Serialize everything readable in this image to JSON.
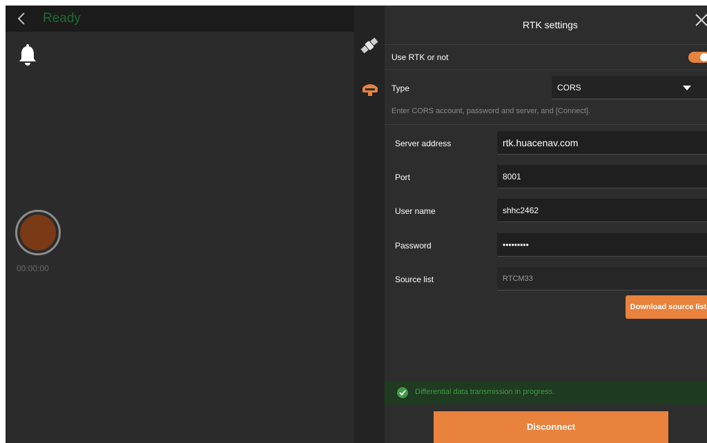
{
  "header": {
    "status": "Ready"
  },
  "recorder": {
    "timer": "00:00:00"
  },
  "panel": {
    "title": "RTK settings",
    "use_rtk": {
      "label": "Use RTK or not",
      "enabled": true
    },
    "type": {
      "label": "Type",
      "value": "CORS"
    },
    "hint": "Enter CORS account, password and server, and [Connect].",
    "fields": {
      "server": {
        "label": "Server address",
        "value": "rtk.huacenav.com"
      },
      "port": {
        "label": "Port",
        "value": "8001"
      },
      "user": {
        "label": "User name",
        "value": "shhc2462"
      },
      "password": {
        "label": "Password",
        "value": "•••••••••"
      },
      "source": {
        "label": "Source list",
        "value": "RTCM33"
      }
    },
    "download_label": "Download source list",
    "transmission_status": "Differential data transmission in progress.",
    "disconnect_label": "Disconnect"
  },
  "colors": {
    "accent": "#e8823d",
    "status_green": "#3f9a45",
    "ready_green": "#1f6b33"
  }
}
